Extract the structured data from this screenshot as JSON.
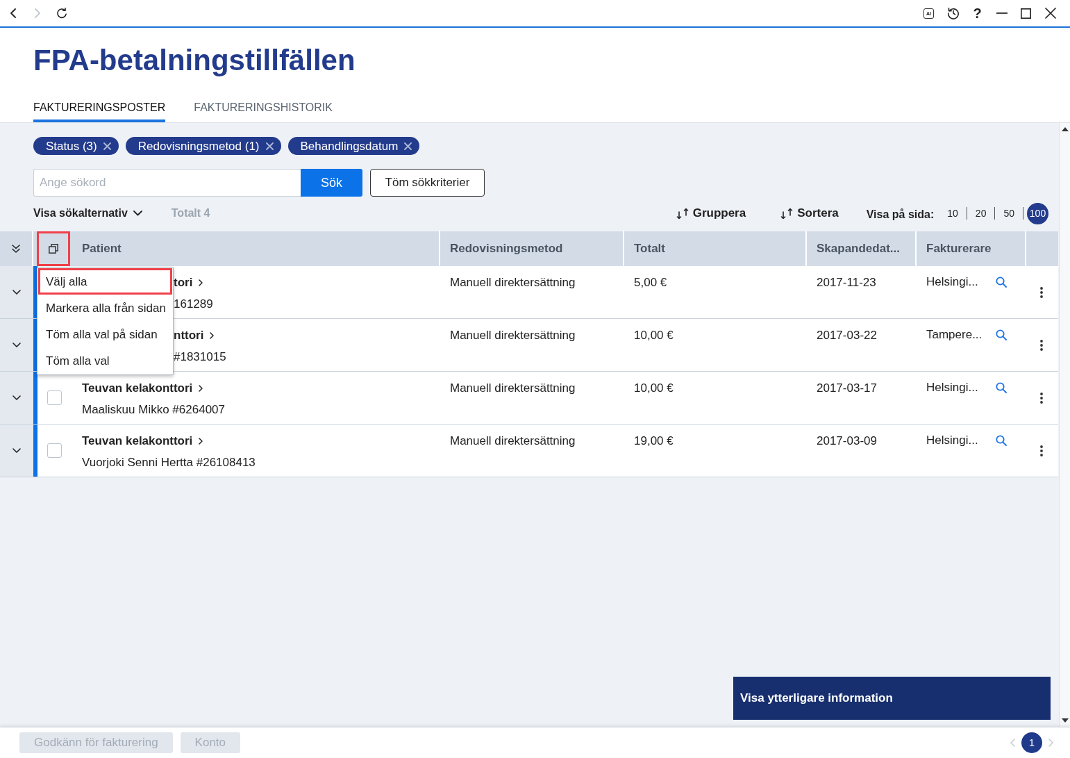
{
  "nav_buttons": [
    {
      "kind": "back",
      "disabled": false
    },
    {
      "kind": "forward",
      "disabled": true
    },
    {
      "kind": "reload",
      "disabled": false
    }
  ],
  "window_controls": {
    "ai_label": "AI",
    "help_label": "?"
  },
  "title": "FPA-betalningstillfällen",
  "tabs": [
    {
      "label": "FAKTURERINGSPOSTER",
      "selected": true
    },
    {
      "label": "FAKTURERINGSHISTORIK",
      "selected": false
    }
  ],
  "filter_chips": [
    {
      "label": "Status (3)"
    },
    {
      "label": "Redovisningsmetod (1)"
    },
    {
      "label": "Behandlingsdatum"
    }
  ],
  "search": {
    "placeholder": "Ange sökord",
    "button": "Sök",
    "clear_button": "Töm sökkriterier"
  },
  "options_toggle": "Visa sökalternativ",
  "total": "Totalt 4",
  "group_button": "Gruppera",
  "sort_button": "Sortera",
  "per_page": {
    "label": "Visa på sida:",
    "options": [
      {
        "label": "10",
        "selected": false
      },
      {
        "label": "20",
        "selected": false
      },
      {
        "label": "50",
        "selected": false
      },
      {
        "label": "100",
        "selected": true
      }
    ]
  },
  "table": {
    "select_control": {
      "highlighted": true
    },
    "columns": [
      "Patient",
      "Redovisningsmetod",
      "Totalt",
      "Skapandedat...",
      "Fakturerare"
    ],
    "rows": [
      {
        "kind": "covered",
        "office": "tori",
        "patient": "161289",
        "method": "Manuell direktersättning",
        "total": "5,00 €",
        "created": "2017-11-23",
        "biller": "Helsingi..."
      },
      {
        "kind": "covered",
        "office": "nttori",
        "patient": "#1831015",
        "method": "Manuell direktersättning",
        "total": "10,00 €",
        "created": "2017-03-22",
        "biller": "Tampere..."
      },
      {
        "kind": "plain",
        "checked": false,
        "office": "Teuvan kelakonttori",
        "patient": "Maaliskuu Mikko #6264007",
        "method": "Manuell direktersättning",
        "total": "10,00 €",
        "created": "2017-03-17",
        "biller": "Helsingi..."
      },
      {
        "kind": "plain",
        "checked": false,
        "office": "Teuvan kelakonttori",
        "patient": "Vuorjoki Senni Hertta #26108413",
        "method": "Manuell direktersättning",
        "total": "19,00 €",
        "created": "2017-03-09",
        "biller": "Helsingi..."
      }
    ]
  },
  "select_menu": {
    "items": [
      {
        "label": "Välj alla",
        "highlighted": true
      },
      {
        "label": "Markera alla från sidan",
        "highlighted": false
      },
      {
        "label": "Töm alla val på sidan",
        "highlighted": false
      },
      {
        "label": "Töm alla val",
        "highlighted": false
      }
    ]
  },
  "info_button": "Visa ytterligare information",
  "footer": {
    "buttons": [
      {
        "label": "Godkänn för fakturering",
        "disabled": true
      },
      {
        "label": "Konto",
        "disabled": true
      }
    ],
    "pagination": {
      "previous": {
        "disabled": true
      },
      "pages": [
        {
          "label": "1",
          "selected": true
        }
      ],
      "next": {
        "disabled": true
      }
    }
  }
}
